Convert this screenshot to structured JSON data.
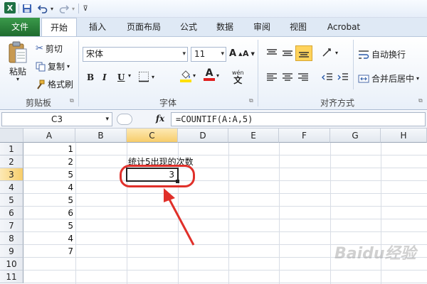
{
  "qat": {
    "app_icon": "X",
    "save_icon": "save-icon",
    "undo_icon": "undo-icon",
    "redo_icon": "redo-icon",
    "customize_icon": "customize-arrow-icon"
  },
  "tabs": [
    {
      "label": "文件"
    },
    {
      "label": "开始"
    },
    {
      "label": "插入"
    },
    {
      "label": "页面布局"
    },
    {
      "label": "公式"
    },
    {
      "label": "数据"
    },
    {
      "label": "审阅"
    },
    {
      "label": "视图"
    },
    {
      "label": "Acrobat"
    }
  ],
  "ribbon": {
    "clipboard": {
      "paste_label": "粘贴",
      "cut_label": "剪切",
      "copy_label": "复制",
      "format_painter_label": "格式刷",
      "group_label": "剪贴板"
    },
    "font": {
      "font_name": "宋体",
      "font_size": "11",
      "grow_label": "A",
      "shrink_label": "A",
      "bold_label": "B",
      "italic_label": "I",
      "underline_label": "U",
      "fill_label": "◈",
      "color_label": "A",
      "wen_label": "wén",
      "group_label": "字体"
    },
    "align": {
      "wrap_label": "自动换行",
      "merge_label": "合并后居中",
      "group_label": "对齐方式"
    },
    "colors": {
      "highlight": "#ffe000",
      "font_red": "#e02020",
      "selected": "#ffd35c"
    }
  },
  "formula_bar": {
    "name_box": "C3",
    "fx": "fx",
    "formula": "=COUNTIF(A:A,5)"
  },
  "sheet": {
    "columns": [
      "A",
      "B",
      "C",
      "D",
      "E",
      "F",
      "G",
      "H"
    ],
    "selected_column": "C",
    "rows": [
      "1",
      "2",
      "3",
      "4",
      "5",
      "6",
      "7",
      "8",
      "9",
      "10",
      "11"
    ],
    "selected_row": "3",
    "col_a_values": [
      "1",
      "2",
      "5",
      "4",
      "5",
      "6",
      "5",
      "4",
      "7"
    ],
    "c2_text": "统计5出现的次数",
    "c3_value": "3"
  },
  "watermark": {
    "text": "Baidu经验"
  },
  "annotation_color": "#e0302a"
}
